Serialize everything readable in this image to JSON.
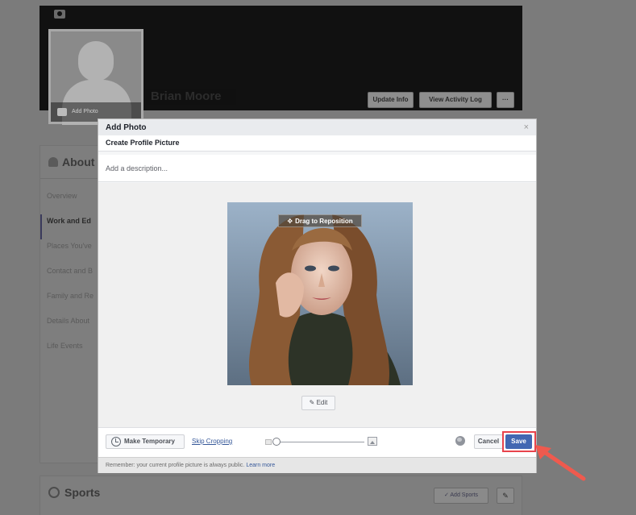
{
  "cover": {
    "user_name": "Brian Moore",
    "add_photo": "Add Photo",
    "buttons": {
      "update_info": "Update Info",
      "view_activity_log": "View Activity Log",
      "more": "···"
    }
  },
  "about": {
    "title": "About",
    "nav": [
      {
        "label": "Overview",
        "active": false
      },
      {
        "label": "Work and Ed",
        "active": true
      },
      {
        "label": "Places You've",
        "active": false
      },
      {
        "label": "Contact and B",
        "active": false
      },
      {
        "label": "Family and Re",
        "active": false
      },
      {
        "label": "Details About",
        "active": false
      },
      {
        "label": "Life Events",
        "active": false
      }
    ]
  },
  "sports": {
    "title": "Sports",
    "add_button": "✓ Add Sports",
    "edit_icon": "pencil-icon"
  },
  "modal": {
    "header_title": "Add Photo",
    "close_icon": "×",
    "subtitle": "Create Profile Picture",
    "description_placeholder": "Add a description...",
    "drag_hint_icon": "✥",
    "drag_hint": "Drag to Reposition",
    "edit_button": "Edit",
    "edit_icon": "✎",
    "footer": {
      "make_temporary": "Make Temporary",
      "skip_cropping": "Skip Cropping",
      "cancel": "Cancel",
      "save": "Save"
    },
    "zoom_level": 0,
    "note": "Remember: your current profile picture is always public.",
    "note_link": "Learn more"
  },
  "colors": {
    "accent_blue": "#4267b2",
    "highlight_red": "#e8434c",
    "link_blue": "#365899"
  }
}
